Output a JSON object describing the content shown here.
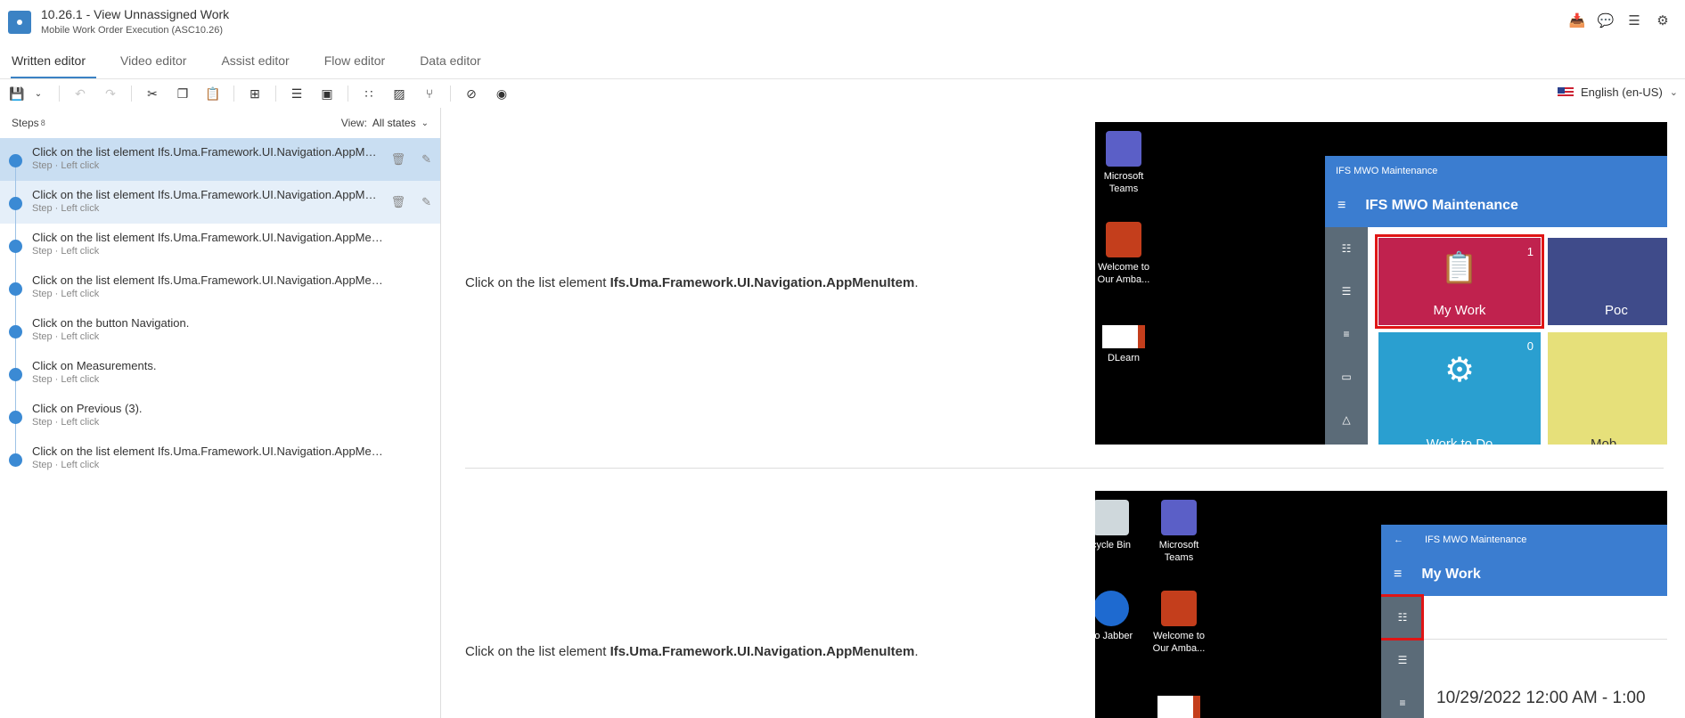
{
  "header": {
    "title": "10.26.1 - View Unnassigned Work",
    "subtitle": "Mobile Work Order Execution (ASC10.26)",
    "icons": [
      "inbox-download-icon",
      "comment-icon",
      "list-icon",
      "gear-icon"
    ]
  },
  "tabs": [
    {
      "label": "Written editor",
      "active": true
    },
    {
      "label": "Video editor",
      "active": false
    },
    {
      "label": "Assist editor",
      "active": false
    },
    {
      "label": "Flow editor",
      "active": false
    },
    {
      "label": "Data editor",
      "active": false
    }
  ],
  "toolbar": {
    "language": "English (en-US)"
  },
  "steps_panel": {
    "label": "Steps",
    "count": "8",
    "view_label": "View:",
    "view_value": "All states",
    "steps": [
      {
        "title": "Click on the list element Ifs.Uma.Framework.UI.Navigation.AppMenuItem.",
        "sub": "Step · Left click"
      },
      {
        "title": "Click on the list element Ifs.Uma.Framework.UI.Navigation.AppMenuItem.",
        "sub": "Step · Left click"
      },
      {
        "title": "Click on the list element Ifs.Uma.Framework.UI.Navigation.AppMenuItem.",
        "sub": "Step · Left click"
      },
      {
        "title": "Click on the list element Ifs.Uma.Framework.UI.Navigation.AppMenuItem.",
        "sub": "Step · Left click"
      },
      {
        "title": "Click on the button Navigation.",
        "sub": "Step · Left click"
      },
      {
        "title": "Click on Measurements.",
        "sub": "Step · Left click"
      },
      {
        "title": "Click on Previous (3).",
        "sub": "Step · Left click"
      },
      {
        "title": "Click on the list element Ifs.Uma.Framework.UI.Navigation.AppMenuItem.",
        "sub": "Step · Left click"
      }
    ]
  },
  "content": {
    "rows": [
      {
        "prefix": "Click on the list element ",
        "bold": "Ifs.Uma.Framework.UI.Navigation.AppMenuItem",
        "suffix": "."
      },
      {
        "prefix": "Click on the list element ",
        "bold": "Ifs.Uma.Framework.UI.Navigation.AppMenuItem",
        "suffix": "."
      }
    ],
    "shot1": {
      "desktop": [
        "Microsoft Teams",
        "Welcome to Our Amba...",
        "DLearn"
      ],
      "window_title": "IFS MWO Maintenance",
      "app_title": "IFS MWO Maintenance",
      "tiles": [
        {
          "label": "My Work",
          "num": "1",
          "color": "#c0224e"
        },
        {
          "label": "Poc",
          "num": "",
          "color": "#3f4b8a"
        },
        {
          "label": "Work to Do",
          "num": "0",
          "color": "#2a9fd0"
        },
        {
          "label": "Mob",
          "num": "",
          "color": "#e6e07a"
        }
      ]
    },
    "shot2": {
      "desktop": [
        "cycle Bin",
        "Microsoft Teams",
        "co Jabber",
        "Welcome to Our Amba..."
      ],
      "window_title": "IFS MWO Maintenance",
      "app_title": "My Work",
      "date": "10/29/2022 12:00 AM - 1:00"
    }
  }
}
